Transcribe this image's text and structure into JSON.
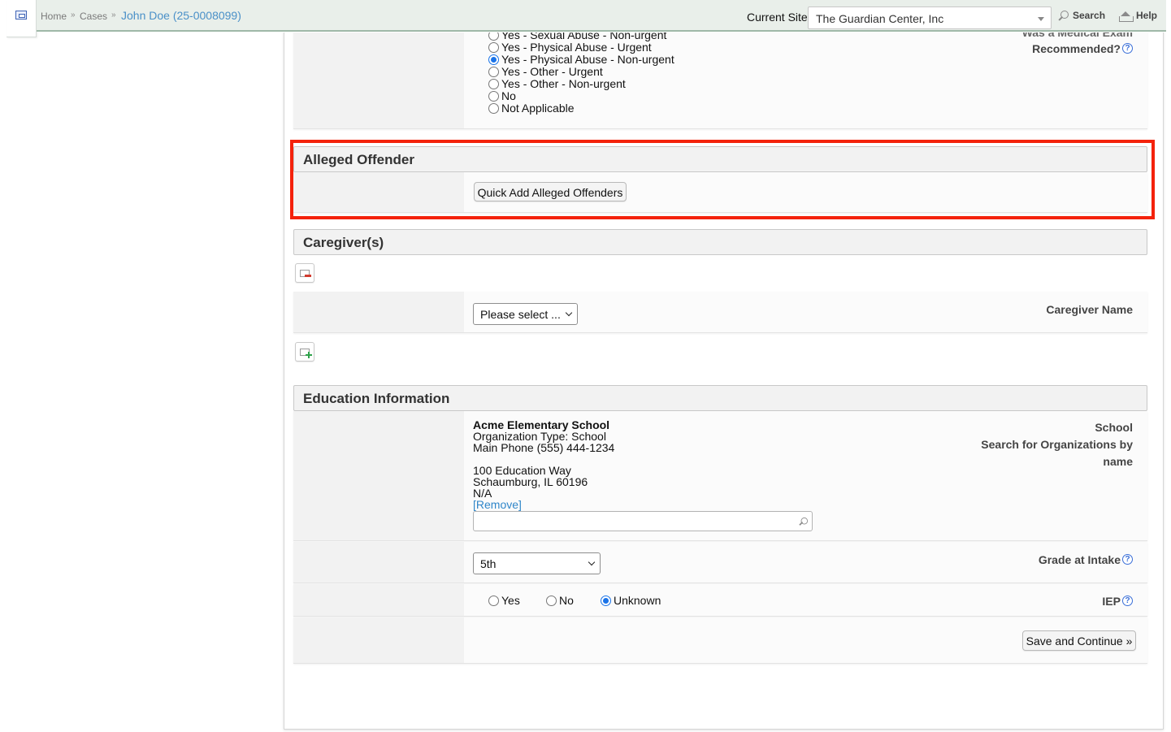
{
  "header": {
    "breadcrumbs": [
      "Home",
      "Cases"
    ],
    "breadcrumb_sep": "»",
    "current_case": "John Doe (25-0008099)",
    "site_label": "Current Site",
    "site_value": "The Guardian Center, Inc",
    "search_label": "Search",
    "help_label": "Help"
  },
  "medical_exam": {
    "label_partial": "Was a Medical Exam",
    "label": "Recommended?",
    "options": [
      {
        "label": "Yes - Sexual Abuse - Non-urgent",
        "checked": false
      },
      {
        "label": "Yes - Physical Abuse - Urgent",
        "checked": false
      },
      {
        "label": "Yes - Physical Abuse - Non-urgent",
        "checked": true
      },
      {
        "label": "Yes - Other - Urgent",
        "checked": false
      },
      {
        "label": "Yes - Other - Non-urgent",
        "checked": false
      },
      {
        "label": "No",
        "checked": false
      },
      {
        "label": "Not Applicable",
        "checked": false
      }
    ]
  },
  "alleged_offender": {
    "title": "Alleged Offender",
    "quick_add_button": "Quick Add Alleged Offenders"
  },
  "caregivers": {
    "title": "Caregiver(s)",
    "name_label": "Caregiver Name",
    "select_value": "Please select ..."
  },
  "education": {
    "title": "Education Information",
    "school_label": "School",
    "school_sublabel_1": "Search for Organizations by",
    "school_sublabel_2": "name",
    "school_name": "Acme Elementary School",
    "org_type": "Organization Type: School",
    "main_phone": "Main Phone  (555) 444-1234",
    "address_1": "100 Education Way",
    "address_2": "Schaumburg, IL 60196",
    "address_3": "N/A",
    "remove_link": "[Remove]",
    "org_search_value": "",
    "grade_label": "Grade at Intake",
    "grade_value": "5th",
    "iep_label": "IEP",
    "iep_options": [
      {
        "label": "Yes",
        "checked": false
      },
      {
        "label": "No",
        "checked": false
      },
      {
        "label": "Unknown",
        "checked": true
      }
    ]
  },
  "footer": {
    "save_button": "Save and Continue »"
  },
  "colors": {
    "highlight": "#f4220b",
    "header_bg": "#e9efea",
    "link": "#2f86c9",
    "radio_selected": "#1a73e8"
  }
}
